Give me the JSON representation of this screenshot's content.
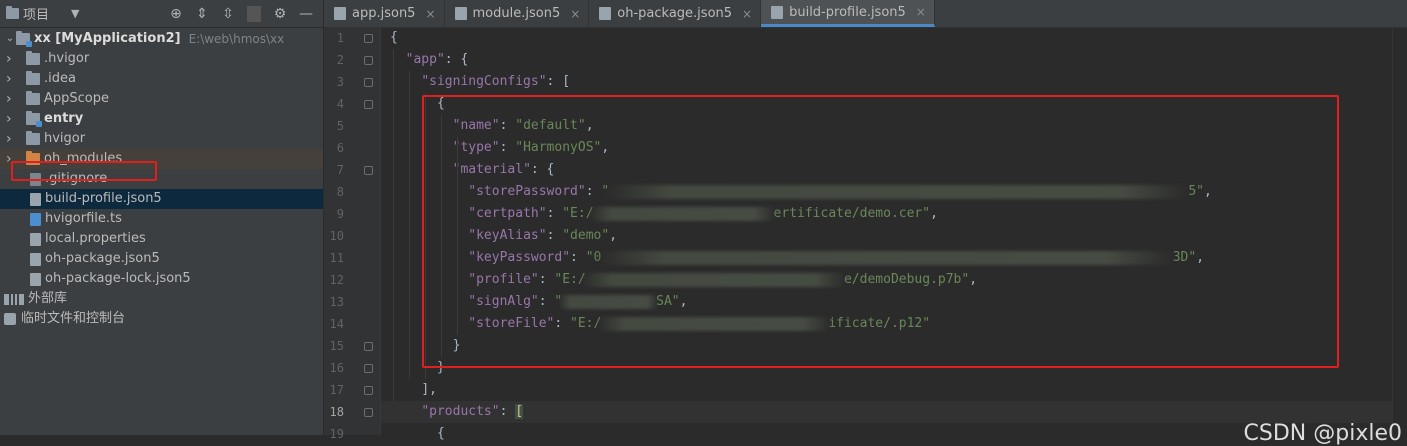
{
  "project_panel": {
    "title": "项目",
    "tree": [
      {
        "label": "xx [MyApplication2]",
        "path": "E:\\web\\hmos\\xx",
        "type": "module-root",
        "indent": 0
      },
      {
        "label": ".hvigor",
        "type": "folder",
        "indent": 1
      },
      {
        "label": ".idea",
        "type": "folder",
        "indent": 1
      },
      {
        "label": "AppScope",
        "type": "folder",
        "indent": 1
      },
      {
        "label": "entry",
        "type": "module-folder",
        "indent": 1
      },
      {
        "label": "hvigor",
        "type": "folder",
        "indent": 1
      },
      {
        "label": "oh_modules",
        "type": "orange-folder",
        "indent": 1
      },
      {
        "label": ".gitignore",
        "type": "file",
        "indent": 1
      },
      {
        "label": "build-profile.json5",
        "type": "json-file",
        "indent": 1,
        "selected": true
      },
      {
        "label": "hvigorfile.ts",
        "type": "ts-file",
        "indent": 1
      },
      {
        "label": "local.properties",
        "type": "file",
        "indent": 1
      },
      {
        "label": "oh-package.json5",
        "type": "json-file",
        "indent": 1
      },
      {
        "label": "oh-package-lock.json5",
        "type": "json-file",
        "indent": 1
      },
      {
        "label": "外部库",
        "type": "libraries",
        "indent": 0
      },
      {
        "label": "临时文件和控制台",
        "type": "scratches",
        "indent": 0
      }
    ]
  },
  "tabs": [
    {
      "label": "app.json5",
      "close": "×",
      "active": false
    },
    {
      "label": "module.json5",
      "close": "×",
      "active": false
    },
    {
      "label": "oh-package.json5",
      "close": "×",
      "active": false
    },
    {
      "label": "build-profile.json5",
      "close": "×",
      "active": true
    }
  ],
  "editor": {
    "line_numbers": [
      "1",
      "2",
      "3",
      "4",
      "5",
      "6",
      "7",
      "8",
      "9",
      "10",
      "11",
      "12",
      "13",
      "14",
      "15",
      "16",
      "17",
      "18",
      "19"
    ],
    "current_line": "18",
    "lines": [
      {
        "indent": 0,
        "parts": [
          {
            "t": "p",
            "v": "{"
          }
        ]
      },
      {
        "indent": 1,
        "parts": [
          {
            "t": "k",
            "v": "\"app\""
          },
          {
            "t": "p",
            "v": ": {"
          }
        ]
      },
      {
        "indent": 2,
        "parts": [
          {
            "t": "k",
            "v": "\"signingConfigs\""
          },
          {
            "t": "p",
            "v": ": ["
          }
        ]
      },
      {
        "indent": 3,
        "parts": [
          {
            "t": "p",
            "v": "{"
          }
        ]
      },
      {
        "indent": 4,
        "parts": [
          {
            "t": "k",
            "v": "\"name\""
          },
          {
            "t": "p",
            "v": ": "
          },
          {
            "t": "s",
            "v": "\"default\""
          },
          {
            "t": "p",
            "v": ","
          }
        ]
      },
      {
        "indent": 4,
        "parts": [
          {
            "t": "k",
            "v": "\"type\""
          },
          {
            "t": "p",
            "v": ": "
          },
          {
            "t": "s",
            "v": "\"HarmonyOS\""
          },
          {
            "t": "p",
            "v": ","
          }
        ]
      },
      {
        "indent": 4,
        "parts": [
          {
            "t": "k",
            "v": "\"material\""
          },
          {
            "t": "p",
            "v": ": {"
          }
        ]
      },
      {
        "indent": 5,
        "parts": [
          {
            "t": "k",
            "v": "\"storePassword\""
          },
          {
            "t": "p",
            "v": ": "
          },
          {
            "t": "s",
            "v": "\""
          },
          {
            "t": "gap",
            "v": "                                                                          "
          },
          {
            "t": "s",
            "v": "5\""
          },
          {
            "t": "p",
            "v": ","
          }
        ]
      },
      {
        "indent": 5,
        "parts": [
          {
            "t": "k",
            "v": "\"certpath\""
          },
          {
            "t": "p",
            "v": ": "
          },
          {
            "t": "s",
            "v": "\"E:/"
          },
          {
            "t": "gap",
            "v": "                       "
          },
          {
            "t": "s",
            "v": "ertificate/demo.cer\""
          },
          {
            "t": "p",
            "v": ","
          }
        ]
      },
      {
        "indent": 5,
        "parts": [
          {
            "t": "k",
            "v": "\"keyAlias\""
          },
          {
            "t": "p",
            "v": ": "
          },
          {
            "t": "s",
            "v": "\"demo\""
          },
          {
            "t": "p",
            "v": ","
          }
        ]
      },
      {
        "indent": 5,
        "parts": [
          {
            "t": "k",
            "v": "\"keyPassword\""
          },
          {
            "t": "p",
            "v": ": "
          },
          {
            "t": "s",
            "v": "\"0"
          },
          {
            "t": "gap",
            "v": "                                                                         "
          },
          {
            "t": "s",
            "v": "3D\""
          },
          {
            "t": "p",
            "v": ","
          }
        ]
      },
      {
        "indent": 5,
        "parts": [
          {
            "t": "k",
            "v": "\"profile\""
          },
          {
            "t": "p",
            "v": ": "
          },
          {
            "t": "s",
            "v": "\"E:/"
          },
          {
            "t": "gap",
            "v": "                                 "
          },
          {
            "t": "s",
            "v": "e/demoDebug.p7b\""
          },
          {
            "t": "p",
            "v": ","
          }
        ]
      },
      {
        "indent": 5,
        "parts": [
          {
            "t": "k",
            "v": "\"signAlg\""
          },
          {
            "t": "p",
            "v": ": "
          },
          {
            "t": "s",
            "v": "\""
          },
          {
            "t": "gap",
            "v": "            "
          },
          {
            "t": "s",
            "v": "SA\""
          },
          {
            "t": "p",
            "v": ","
          }
        ]
      },
      {
        "indent": 5,
        "parts": [
          {
            "t": "k",
            "v": "\"storeFile\""
          },
          {
            "t": "p",
            "v": ": "
          },
          {
            "t": "s",
            "v": "\"E:/"
          },
          {
            "t": "gap",
            "v": "                             "
          },
          {
            "t": "s",
            "v": "ificate/.p12\""
          }
        ]
      },
      {
        "indent": 4,
        "parts": [
          {
            "t": "p",
            "v": "}"
          }
        ]
      },
      {
        "indent": 3,
        "parts": [
          {
            "t": "p",
            "v": "}"
          }
        ]
      },
      {
        "indent": 2,
        "parts": [
          {
            "t": "p",
            "v": "],"
          }
        ]
      },
      {
        "indent": 2,
        "parts": [
          {
            "t": "k",
            "v": "\"products\""
          },
          {
            "t": "p",
            "v": ": "
          },
          {
            "t": "br",
            "v": "["
          }
        ]
      },
      {
        "indent": 3,
        "parts": [
          {
            "t": "p",
            "v": "{"
          }
        ]
      }
    ]
  },
  "watermark": "CSDN @pixle0",
  "colors": {
    "accent": "#4a88c7",
    "highlight": "#e0201f",
    "selection": "#0d293e"
  }
}
